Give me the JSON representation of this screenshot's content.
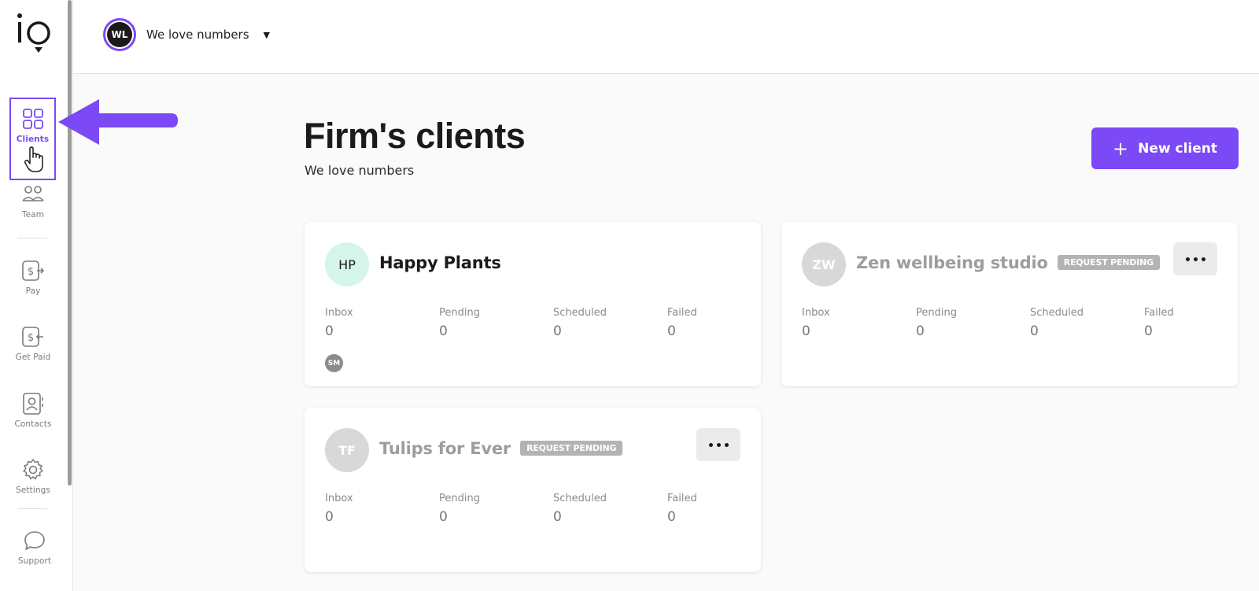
{
  "colors": {
    "accent": "#7b49f5",
    "hp_avatar_bg": "#d6f5ea",
    "badge_bg": "#b3b3b3"
  },
  "sidebar": {
    "logo": "io",
    "items": [
      {
        "id": "clients",
        "label": "Clients",
        "icon": "grid-icon",
        "active": true
      },
      {
        "id": "team",
        "label": "Team",
        "icon": "team-icon",
        "active": false
      },
      {
        "id": "pay",
        "label": "Pay",
        "icon": "pay-icon",
        "active": false
      },
      {
        "id": "get-paid",
        "label": "Get Paid",
        "icon": "get-paid-icon",
        "active": false
      },
      {
        "id": "contacts",
        "label": "Contacts",
        "icon": "contacts-icon",
        "active": false
      },
      {
        "id": "settings",
        "label": "Settings",
        "icon": "gear-icon",
        "active": false
      },
      {
        "id": "support",
        "label": "Support",
        "icon": "chat-bubble-icon",
        "active": false
      }
    ]
  },
  "header": {
    "firm_initials": "WL",
    "firm_name": "We love numbers"
  },
  "main": {
    "title": "Firm's clients",
    "subtitle": "We love numbers",
    "new_client_label": "New client",
    "stat_labels": [
      "Inbox",
      "Pending",
      "Scheduled",
      "Failed"
    ],
    "clients": [
      {
        "initials": "HP",
        "name": "Happy Plants",
        "pending_request": false,
        "badge": "",
        "stats": [
          "0",
          "0",
          "0",
          "0"
        ],
        "members": [
          "SM"
        ]
      },
      {
        "initials": "ZW",
        "name": "Zen wellbeing studio",
        "pending_request": true,
        "badge": "REQUEST PENDING",
        "stats": [
          "0",
          "0",
          "0",
          "0"
        ],
        "members": []
      },
      {
        "initials": "TF",
        "name": "Tulips for Ever",
        "pending_request": true,
        "badge": "REQUEST PENDING",
        "stats": [
          "0",
          "0",
          "0",
          "0"
        ],
        "members": []
      }
    ]
  }
}
